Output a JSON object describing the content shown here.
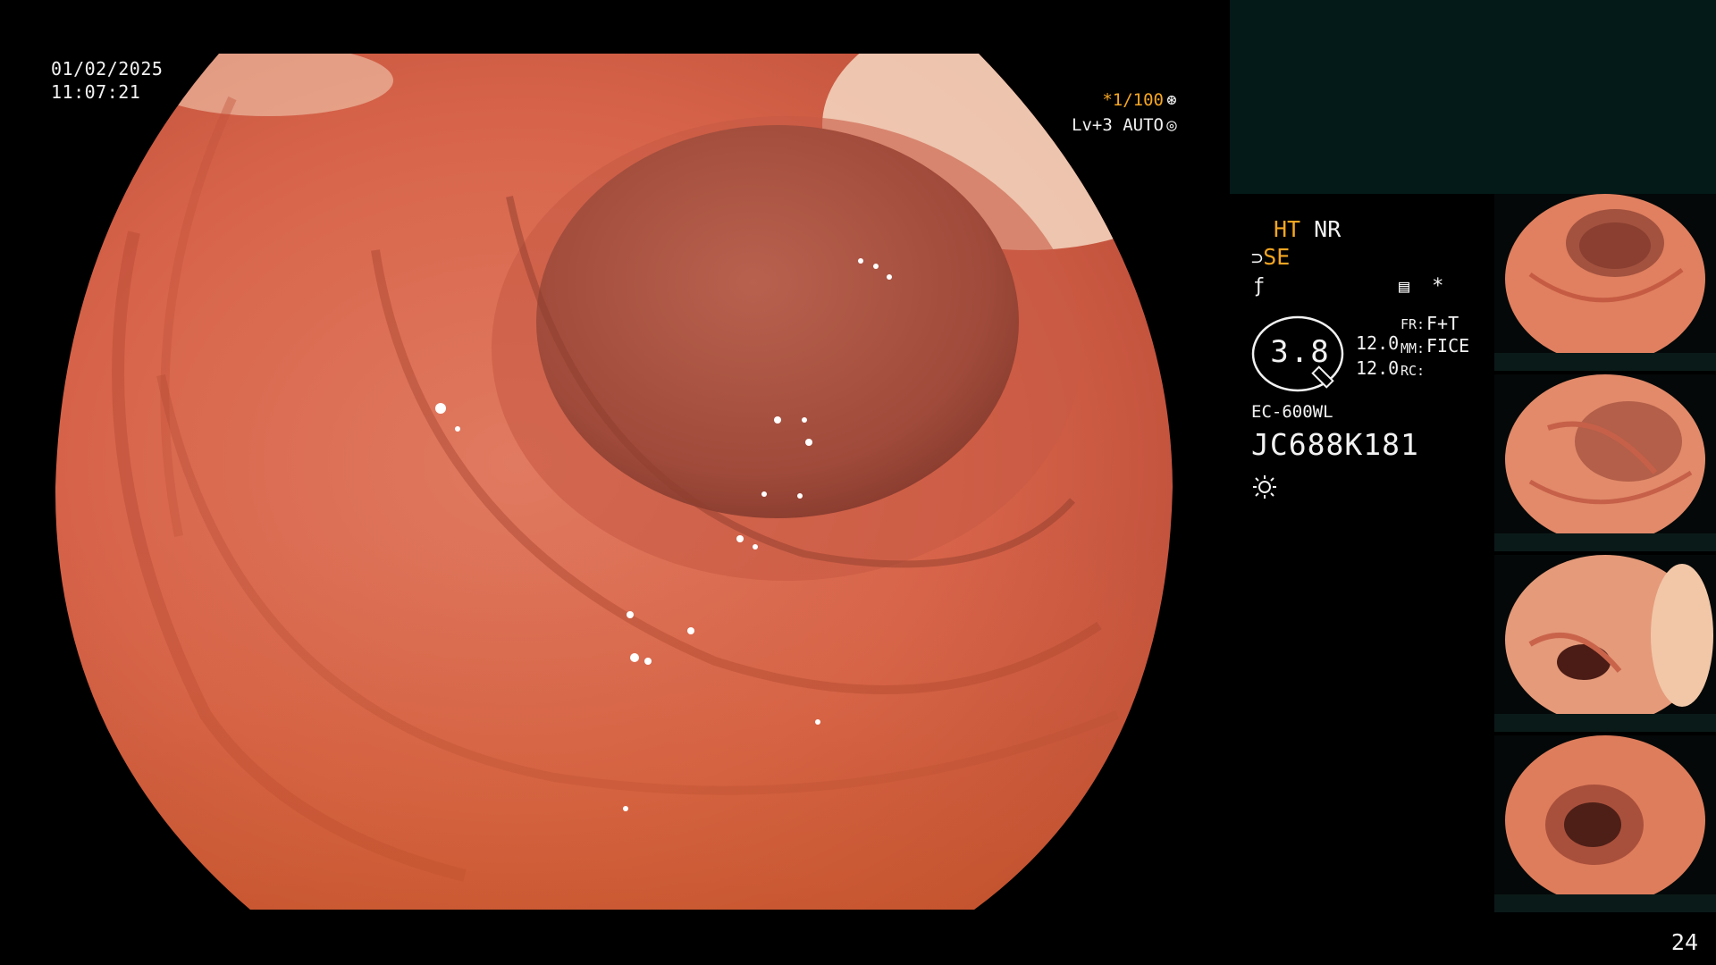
{
  "overlay": {
    "date": "01/02/2025",
    "time": "11:07:21",
    "shutter": "*1/100",
    "shutter_icon": "aperture-icon",
    "level": "Lv+3 AUTO",
    "level_icon": "iris-icon"
  },
  "modes": {
    "ht": "HT",
    "nr": "NR",
    "se": "SE",
    "se_icon": "structure-enhance-icon",
    "f_icon": "color-mode-icon",
    "record_icon": "record-icon",
    "asterisk": "*"
  },
  "dial": {
    "value": "3.8",
    "p1": "12.0",
    "p2": "12.0",
    "fr_key": "FR:",
    "fr_val": "F+T",
    "mm_key": "MM:",
    "mm_val": "FICE",
    "rc_key": "RC:"
  },
  "scope": {
    "model": "EC-600WL",
    "serial": "JC688K181",
    "light_icon": "light-source-icon"
  },
  "thumbnails": [
    {
      "label": "thumbnail-1"
    },
    {
      "label": "thumbnail-2"
    },
    {
      "label": "thumbnail-3"
    },
    {
      "label": "thumbnail-4"
    }
  ],
  "page_number": "24",
  "colors": {
    "accent_orange": "#f5a623",
    "tissue": "#d9684d",
    "top_panel": "#031a19"
  }
}
